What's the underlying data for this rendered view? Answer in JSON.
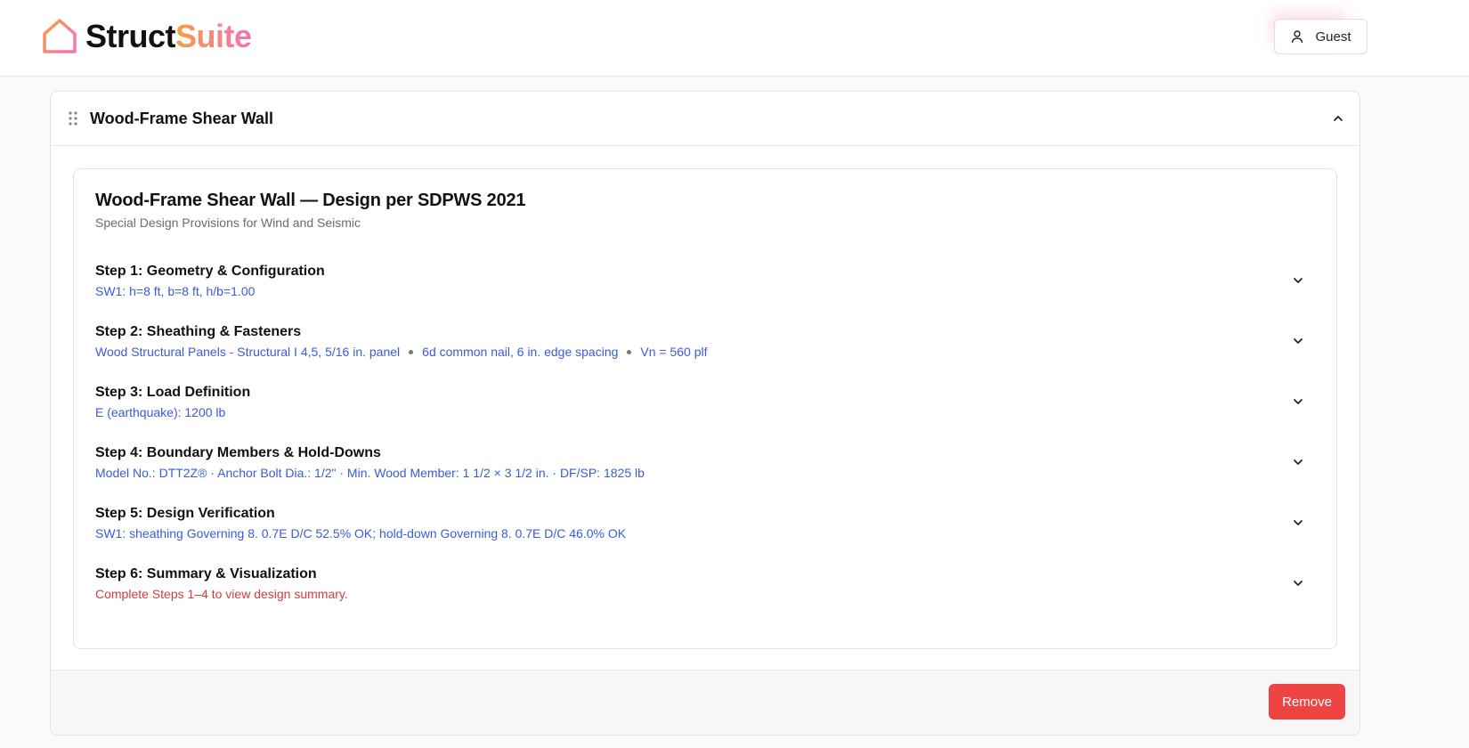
{
  "app": {
    "brand_part1": "Struct",
    "brand_part2": "Suite",
    "logo_icon": "house-outline-icon",
    "accent_gradient": [
      "#f59e42",
      "#f472b6"
    ]
  },
  "header": {
    "user_label": "Guest",
    "user_icon": "user-icon"
  },
  "panel": {
    "title": "Wood-Frame Shear Wall",
    "drag_icon": "drag-handle-icon",
    "collapse_icon": "chevron-up-icon",
    "calc_title": "Wood-Frame Shear Wall — Design per SDPWS 2021",
    "calc_subtitle": "Special Design Provisions for Wind and Seismic",
    "remove_label": "Remove",
    "remove_color": "#ef4444"
  },
  "steps": [
    {
      "title": "Step 1: Geometry & Configuration",
      "summary": [
        "SW1: h=8 ft, b=8 ft, h/b=1.00"
      ],
      "status": "info"
    },
    {
      "title": "Step 2: Sheathing & Fasteners",
      "summary": [
        "Wood Structural Panels - Structural I 4,5, 5/16 in. panel",
        "6d common nail, 6 in. edge spacing",
        "Vn = 560 plf"
      ],
      "status": "info"
    },
    {
      "title": "Step 3: Load Definition",
      "summary": [
        "E (earthquake): 1200 lb"
      ],
      "status": "info"
    },
    {
      "title": "Step 4: Boundary Members & Hold-Downs",
      "summary": [
        "Model No.: DTT2Z® · Anchor Bolt Dia.: 1/2\" · Min. Wood Member: 1 1/2 × 3 1/2 in. · DF/SP: 1825 lb"
      ],
      "status": "info"
    },
    {
      "title": "Step 5: Design Verification",
      "summary": [
        "SW1: sheathing Governing 8. 0.7E D/C 52.5% OK; hold-down Governing 8. 0.7E D/C 46.0% OK"
      ],
      "status": "info"
    },
    {
      "title": "Step 6: Summary & Visualization",
      "summary": [
        "Complete Steps 1–4 to view design summary."
      ],
      "status": "error"
    }
  ],
  "colors": {
    "summary_info": "#3b5bdb",
    "summary_error": "#d63c3c"
  }
}
